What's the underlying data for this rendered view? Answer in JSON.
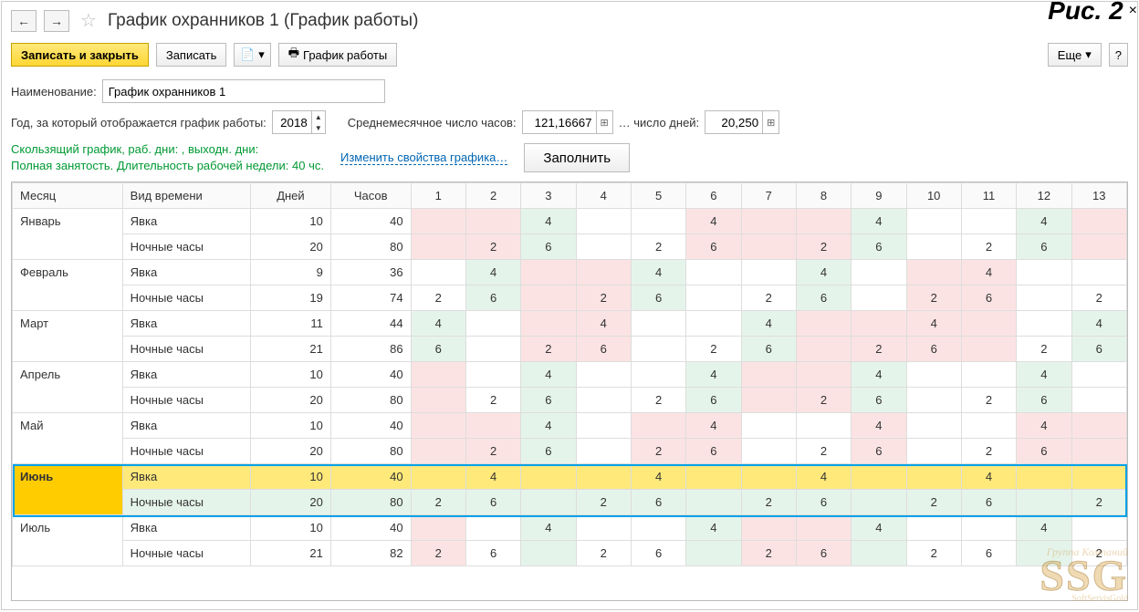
{
  "figure_label": "Рис. 2",
  "header": {
    "title": "График охранников 1 (График работы)"
  },
  "toolbar": {
    "save_close": "Записать и закрыть",
    "save": "Записать",
    "schedule_btn": "График работы",
    "more": "Еще",
    "help": "?"
  },
  "fields": {
    "name_label": "Наименование:",
    "name_value": "График охранников 1",
    "year_label": "Год, за который отображается график работы:",
    "year_value": "2018",
    "avg_hours_label": "Среднемесячное число часов:",
    "avg_hours_value": "121,16667",
    "avg_days_label": "… число дней:",
    "avg_days_value": "20,250"
  },
  "info": {
    "line1": "Скользящий график, раб. дни: , выходн. дни:",
    "line2": "Полная занятость. Длительность рабочей недели: 40 чс.",
    "change_link": "Изменить свойства графика…",
    "fill_btn": "Заполнить"
  },
  "table": {
    "headers": {
      "month": "Месяц",
      "type": "Вид времени",
      "days": "Дней",
      "hours": "Часов"
    },
    "day_cols": [
      1,
      2,
      3,
      4,
      5,
      6,
      7,
      8,
      9,
      10,
      11,
      12,
      13
    ],
    "months": [
      {
        "name": "Январь",
        "rows": [
          {
            "type": "Явка",
            "days": 10,
            "hours": 40,
            "cells": [
              {
                "c": "pink"
              },
              {
                "c": "pink"
              },
              {
                "v": 4,
                "c": "green"
              },
              {
                "c": ""
              },
              {
                "c": ""
              },
              {
                "v": 4,
                "c": "pink"
              },
              {
                "c": "pink"
              },
              {
                "c": "pink"
              },
              {
                "v": 4,
                "c": "green"
              },
              {
                "c": ""
              },
              {
                "c": ""
              },
              {
                "v": 4,
                "c": "green"
              },
              {
                "c": "pink"
              }
            ]
          },
          {
            "type": "Ночные часы",
            "days": 20,
            "hours": 80,
            "cells": [
              {
                "c": "pink"
              },
              {
                "v": 2,
                "c": "pink"
              },
              {
                "v": 6,
                "c": "green"
              },
              {
                "c": ""
              },
              {
                "v": 2,
                "c": ""
              },
              {
                "v": 6,
                "c": "pink"
              },
              {
                "c": "pink"
              },
              {
                "v": 2,
                "c": "pink"
              },
              {
                "v": 6,
                "c": "green"
              },
              {
                "c": ""
              },
              {
                "v": 2,
                "c": ""
              },
              {
                "v": 6,
                "c": "green"
              },
              {
                "c": "pink"
              }
            ]
          }
        ]
      },
      {
        "name": "Февраль",
        "rows": [
          {
            "type": "Явка",
            "days": 9,
            "hours": 36,
            "cells": [
              {
                "c": ""
              },
              {
                "v": 4,
                "c": "green"
              },
              {
                "c": "pink"
              },
              {
                "c": "pink"
              },
              {
                "v": 4,
                "c": "green"
              },
              {
                "c": ""
              },
              {
                "c": ""
              },
              {
                "v": 4,
                "c": "green"
              },
              {
                "c": ""
              },
              {
                "c": "pink"
              },
              {
                "v": 4,
                "c": "pink"
              },
              {
                "c": ""
              },
              {
                "c": ""
              }
            ]
          },
          {
            "type": "Ночные часы",
            "days": 19,
            "hours": 74,
            "cells": [
              {
                "v": 2,
                "c": ""
              },
              {
                "v": 6,
                "c": "green"
              },
              {
                "c": "pink"
              },
              {
                "v": 2,
                "c": "pink"
              },
              {
                "v": 6,
                "c": "green"
              },
              {
                "c": ""
              },
              {
                "v": 2,
                "c": ""
              },
              {
                "v": 6,
                "c": "green"
              },
              {
                "c": ""
              },
              {
                "v": 2,
                "c": "pink"
              },
              {
                "v": 6,
                "c": "pink"
              },
              {
                "c": ""
              },
              {
                "v": 2,
                "c": ""
              }
            ]
          }
        ]
      },
      {
        "name": "Март",
        "rows": [
          {
            "type": "Явка",
            "days": 11,
            "hours": 44,
            "cells": [
              {
                "v": 4,
                "c": "green"
              },
              {
                "c": ""
              },
              {
                "c": "pink"
              },
              {
                "v": 4,
                "c": "pink"
              },
              {
                "c": ""
              },
              {
                "c": ""
              },
              {
                "v": 4,
                "c": "green"
              },
              {
                "c": "pink"
              },
              {
                "c": "pink"
              },
              {
                "v": 4,
                "c": "pink"
              },
              {
                "c": "pink"
              },
              {
                "c": ""
              },
              {
                "v": 4,
                "c": "green"
              }
            ]
          },
          {
            "type": "Ночные часы",
            "days": 21,
            "hours": 86,
            "cells": [
              {
                "v": 6,
                "c": "green"
              },
              {
                "c": ""
              },
              {
                "v": 2,
                "c": "pink"
              },
              {
                "v": 6,
                "c": "pink"
              },
              {
                "c": ""
              },
              {
                "v": 2,
                "c": ""
              },
              {
                "v": 6,
                "c": "green"
              },
              {
                "c": "pink"
              },
              {
                "v": 2,
                "c": "pink"
              },
              {
                "v": 6,
                "c": "pink"
              },
              {
                "c": "pink"
              },
              {
                "v": 2,
                "c": ""
              },
              {
                "v": 6,
                "c": "green"
              }
            ]
          }
        ]
      },
      {
        "name": "Апрель",
        "rows": [
          {
            "type": "Явка",
            "days": 10,
            "hours": 40,
            "cells": [
              {
                "c": "pink"
              },
              {
                "c": ""
              },
              {
                "v": 4,
                "c": "green"
              },
              {
                "c": ""
              },
              {
                "c": ""
              },
              {
                "v": 4,
                "c": "green"
              },
              {
                "c": "pink"
              },
              {
                "c": "pink"
              },
              {
                "v": 4,
                "c": "green"
              },
              {
                "c": ""
              },
              {
                "c": ""
              },
              {
                "v": 4,
                "c": "green"
              },
              {
                "c": ""
              }
            ]
          },
          {
            "type": "Ночные часы",
            "days": 20,
            "hours": 80,
            "cells": [
              {
                "c": "pink"
              },
              {
                "v": 2,
                "c": ""
              },
              {
                "v": 6,
                "c": "green"
              },
              {
                "c": ""
              },
              {
                "v": 2,
                "c": ""
              },
              {
                "v": 6,
                "c": "green"
              },
              {
                "c": "pink"
              },
              {
                "v": 2,
                "c": "pink"
              },
              {
                "v": 6,
                "c": "green"
              },
              {
                "c": ""
              },
              {
                "v": 2,
                "c": ""
              },
              {
                "v": 6,
                "c": "green"
              },
              {
                "c": ""
              }
            ]
          }
        ]
      },
      {
        "name": "Май",
        "rows": [
          {
            "type": "Явка",
            "days": 10,
            "hours": 40,
            "cells": [
              {
                "c": "pink"
              },
              {
                "c": "pink"
              },
              {
                "v": 4,
                "c": "green"
              },
              {
                "c": ""
              },
              {
                "c": "pink"
              },
              {
                "v": 4,
                "c": "pink"
              },
              {
                "c": ""
              },
              {
                "c": ""
              },
              {
                "v": 4,
                "c": "pink"
              },
              {
                "c": ""
              },
              {
                "c": ""
              },
              {
                "v": 4,
                "c": "pink"
              },
              {
                "c": "pink"
              }
            ]
          },
          {
            "type": "Ночные часы",
            "days": 20,
            "hours": 80,
            "cells": [
              {
                "c": "pink"
              },
              {
                "v": 2,
                "c": "pink"
              },
              {
                "v": 6,
                "c": "green"
              },
              {
                "c": ""
              },
              {
                "v": 2,
                "c": "pink"
              },
              {
                "v": 6,
                "c": "pink"
              },
              {
                "c": ""
              },
              {
                "v": 2,
                "c": ""
              },
              {
                "v": 6,
                "c": "pink"
              },
              {
                "c": ""
              },
              {
                "v": 2,
                "c": ""
              },
              {
                "v": 6,
                "c": "pink"
              },
              {
                "c": "pink"
              }
            ]
          }
        ]
      },
      {
        "name": "Июнь",
        "selected": true,
        "rows": [
          {
            "type": "Явка",
            "days": 10,
            "hours": 40,
            "sel": "y",
            "cells": [
              {
                "c": ""
              },
              {
                "v": 4,
                "c": ""
              },
              {
                "c": ""
              },
              {
                "c": ""
              },
              {
                "v": 4,
                "c": ""
              },
              {
                "c": ""
              },
              {
                "c": ""
              },
              {
                "v": 4,
                "c": ""
              },
              {
                "c": ""
              },
              {
                "c": ""
              },
              {
                "v": 4,
                "c": ""
              },
              {
                "c": ""
              },
              {
                "c": ""
              }
            ]
          },
          {
            "type": "Ночные часы",
            "days": 20,
            "hours": 80,
            "sel": "n",
            "cells": [
              {
                "v": 2,
                "c": "green"
              },
              {
                "v": 6,
                "c": "pink"
              },
              {
                "c": "pink"
              },
              {
                "v": 2,
                "c": "green"
              },
              {
                "v": 6,
                "c": "green"
              },
              {
                "c": ""
              },
              {
                "v": 2,
                "c": "green"
              },
              {
                "v": 6,
                "c": "green"
              },
              {
                "c": "pink"
              },
              {
                "v": 2,
                "c": "pink"
              },
              {
                "v": 6,
                "c": "green"
              },
              {
                "c": "pink"
              },
              {
                "v": 2,
                "c": "green"
              }
            ]
          }
        ]
      },
      {
        "name": "Июль",
        "rows": [
          {
            "type": "Явка",
            "days": 10,
            "hours": 40,
            "cells": [
              {
                "c": "pink"
              },
              {
                "c": ""
              },
              {
                "v": 4,
                "c": "green"
              },
              {
                "c": ""
              },
              {
                "c": ""
              },
              {
                "v": 4,
                "c": "green"
              },
              {
                "c": "pink"
              },
              {
                "c": "pink"
              },
              {
                "v": 4,
                "c": "green"
              },
              {
                "c": ""
              },
              {
                "c": ""
              },
              {
                "v": 4,
                "c": "green"
              },
              {
                "c": ""
              }
            ]
          },
          {
            "type": "Ночные часы",
            "days": 21,
            "hours": 82,
            "cells": [
              {
                "v": 2,
                "c": "pink"
              },
              {
                "v": 6,
                "c": ""
              },
              {
                "c": "green"
              },
              {
                "v": 2,
                "c": ""
              },
              {
                "v": 6,
                "c": ""
              },
              {
                "c": "green"
              },
              {
                "v": 2,
                "c": "pink"
              },
              {
                "v": 6,
                "c": "pink"
              },
              {
                "c": "green"
              },
              {
                "v": 2,
                "c": ""
              },
              {
                "v": 6,
                "c": ""
              },
              {
                "c": "green"
              },
              {
                "v": 2,
                "c": ""
              }
            ]
          }
        ]
      }
    ]
  },
  "watermark": {
    "line1": "Группа Компаний",
    "logo": "SSG",
    "line2": "SoftServisGold"
  }
}
